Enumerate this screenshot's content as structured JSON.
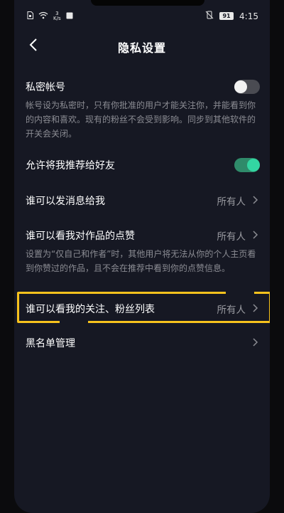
{
  "status_bar": {
    "net_speed_value": "3",
    "net_speed_unit": "K/s",
    "battery": "91",
    "time": "4:15"
  },
  "header": {
    "title": "隐私设置",
    "back_icon": "chevron-left-icon"
  },
  "settings": {
    "private_account": {
      "title": "私密帐号",
      "description": "帐号设为私密时，只有你批准的用户才能关注你，并能看到你的内容和喜欢。现有的粉丝不会受到影响。同步到其他软件的开关会关闭。",
      "enabled": false
    },
    "recommend_to_friends": {
      "title": "允许将我推荐给好友",
      "enabled": true
    },
    "who_can_message": {
      "title": "谁可以发消息给我",
      "value": "所有人"
    },
    "who_can_see_likes": {
      "title": "谁可以看我对作品的点赞",
      "value": "所有人",
      "description": "设置为“仅自己和作者”时，其他用户将无法从你的个人主页看到你赞过的作品，且不会在推荐中看到你的点赞信息。"
    },
    "who_can_see_follows": {
      "title": "谁可以看我的关注、粉丝列表",
      "value": "所有人"
    },
    "blacklist": {
      "title": "黑名单管理"
    }
  },
  "colors": {
    "background": "#161823",
    "toggle_on": "#33d6a2",
    "highlight": "#f7c21d"
  }
}
